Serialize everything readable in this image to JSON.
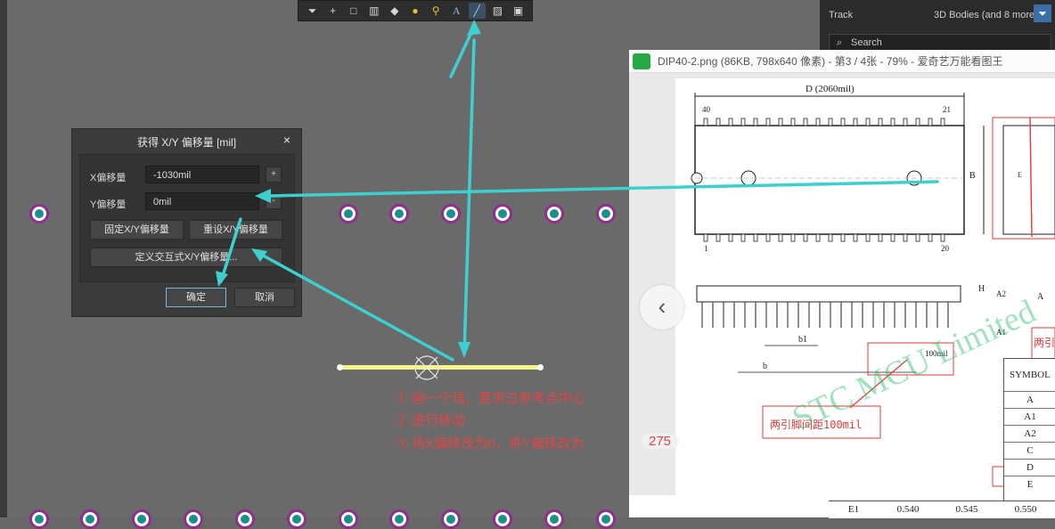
{
  "toolbar": {
    "icons": [
      "filter-icon",
      "cross-icon",
      "rect-icon",
      "chart-icon",
      "brush-icon",
      "pad-icon",
      "via-icon",
      "text-icon",
      "line-icon",
      "graph-icon",
      "image-icon"
    ],
    "active": "line-icon"
  },
  "right_panel": {
    "track_label": "Track",
    "layers_label": "3D Bodies (and 8 more)",
    "search_placeholder": "Search"
  },
  "dialog": {
    "title": "获得 X/Y 偏移量 [mil]",
    "x_label": "X偏移量",
    "x_value": "-1030mil",
    "y_label": "Y偏移量",
    "y_value": "0mil",
    "fixed_button": "固定X/Y偏移量",
    "reset_button": "重设X/Y偏移量",
    "define_button": "定义交互式X/Y偏移量...",
    "ok_button": "确定",
    "cancel_button": "取消",
    "plus": "+",
    "minus": "-",
    "close": "×"
  },
  "viewer": {
    "title": "DIP40-2.png (86KB, 798x640 像素) - 第3 / 4张 - 79% - 爱奇艺万能看图王",
    "prev": "‹"
  },
  "drawing": {
    "dim_label": "D (2060mil)",
    "pin40": "40",
    "pin21": "21",
    "pin1": "1",
    "pin20": "20",
    "label_b": "B",
    "label_E": "E",
    "label_H": "H",
    "label_A2": "A2",
    "label_A": "A",
    "label_A1": "A1",
    "label_b1": "b1",
    "label_b_small": "b",
    "label_100mil": "100mil",
    "annot_pitch": "两引脚间距100mil",
    "annot_right": "两引",
    "watermark": "STC MCU Limited"
  },
  "table": {
    "header": "SYMBOL",
    "rows": [
      "A",
      "A1",
      "A2",
      "C",
      "D",
      "E"
    ],
    "bottom_row": [
      "E1",
      "0.540",
      "0.545",
      "0.550"
    ]
  },
  "notes": [
    "① 画一个线，要求过参考点中心",
    "② 进行移动",
    "③ 将X偏移改为0，将Y偏移改为"
  ],
  "note_value": "275",
  "colors": {
    "canvas": "#6a6a6a",
    "pad_ring": "#8e2e8f",
    "pad_center": "#1b8f8f",
    "arrow": "#3ecfcf",
    "note": "#e04646",
    "track": "#f5f58c"
  }
}
